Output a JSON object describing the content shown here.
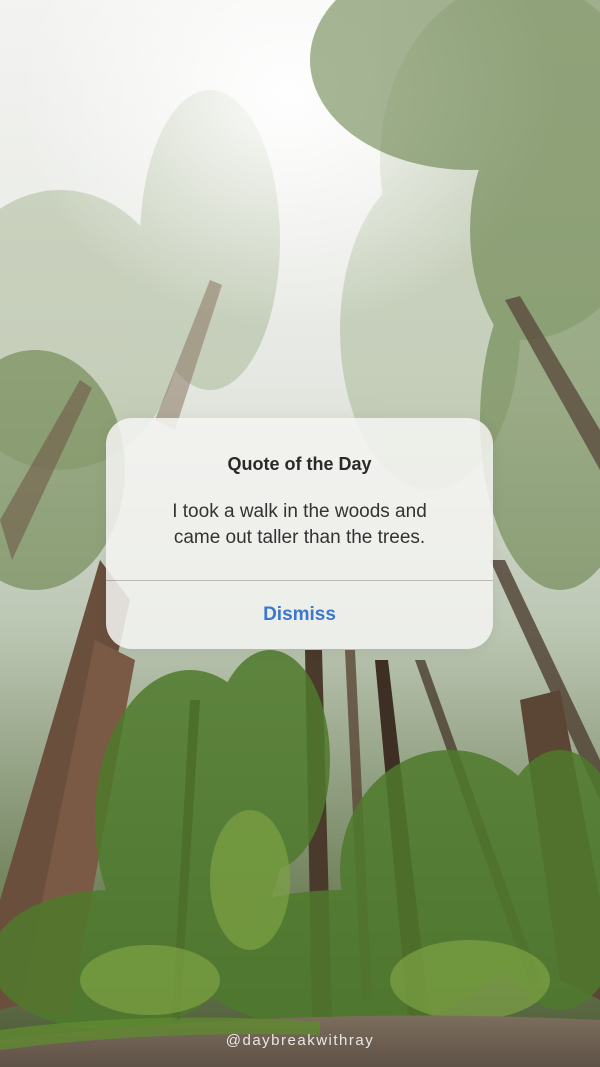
{
  "dialog": {
    "title": "Quote of the Day",
    "message_line_1": "I took a walk in the woods and",
    "message_line_2": "came out taller than the trees.",
    "dismiss_label": "Dismiss",
    "accent_color": "#3b78c9"
  },
  "watermark": {
    "text": "@daybreakwithray"
  },
  "background": {
    "description_icon": "forest-background"
  }
}
